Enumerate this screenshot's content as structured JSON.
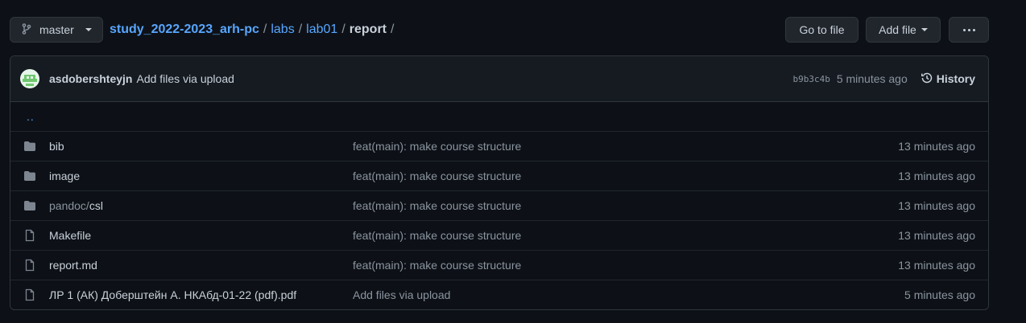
{
  "branch": {
    "label": "master"
  },
  "breadcrumb": {
    "repo": "study_2022-2023_arh-pc",
    "parts": [
      "labs",
      "lab01"
    ],
    "current": "report",
    "separator": "/"
  },
  "actions": {
    "goto_file": "Go to file",
    "add_file": "Add file"
  },
  "commit": {
    "author": "asdobershteyjn",
    "message": "Add files via upload",
    "sha": "b9b3c4b",
    "time": "5 minutes ago",
    "history_label": "History"
  },
  "updir": "..",
  "files": [
    {
      "type": "folder",
      "name_prefix": "",
      "name": "bib",
      "message": "feat(main): make course structure",
      "age": "13 minutes ago"
    },
    {
      "type": "folder",
      "name_prefix": "",
      "name": "image",
      "message": "feat(main): make course structure",
      "age": "13 minutes ago"
    },
    {
      "type": "folder",
      "name_prefix": "pandoc/",
      "name": "csl",
      "message": "feat(main): make course structure",
      "age": "13 minutes ago"
    },
    {
      "type": "file",
      "name_prefix": "",
      "name": "Makefile",
      "message": "feat(main): make course structure",
      "age": "13 minutes ago"
    },
    {
      "type": "file",
      "name_prefix": "",
      "name": "report.md",
      "message": "feat(main): make course structure",
      "age": "13 minutes ago"
    },
    {
      "type": "file",
      "name_prefix": "",
      "name": "ЛР 1 (АК) Доберштейн А. НКАбд-01-22 (pdf).pdf",
      "message": "Add files via upload",
      "age": "5 minutes ago"
    }
  ],
  "colors": {
    "link": "#58a6ff",
    "background": "#0d1117",
    "panel": "#161b22",
    "border": "#30363d"
  }
}
